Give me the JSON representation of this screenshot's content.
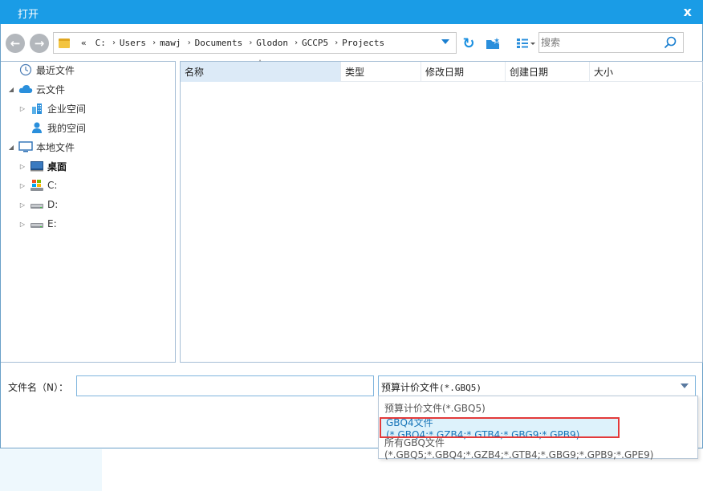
{
  "dialog": {
    "title": "打开",
    "close_glyph": "x"
  },
  "toolbar": {
    "back_icon": "arrow-left-icon",
    "forward_icon": "arrow-right-icon",
    "address": {
      "overflow": "«",
      "segments": [
        "C:",
        "Users",
        "mawj",
        "Documents",
        "Glodon",
        "GCCP5",
        "Projects"
      ],
      "separator": "›"
    },
    "refresh_icon": "refresh-icon",
    "new_folder_icon": "new-folder-icon",
    "view_icon": "view-mode-icon",
    "search": {
      "placeholder": "搜索"
    }
  },
  "tree": {
    "items": [
      {
        "label": "最近文件",
        "icon": "clock-icon",
        "expander": ""
      },
      {
        "label": "云文件",
        "icon": "cloud-icon",
        "expander": "◢"
      },
      {
        "label": "企业空间",
        "icon": "building-icon",
        "expander": "▷"
      },
      {
        "label": "我的空间",
        "icon": "user-icon",
        "expander": ""
      },
      {
        "label": "本地文件",
        "icon": "monitor-icon",
        "expander": "◢"
      },
      {
        "label": "桌面",
        "icon": "desktop-icon",
        "expander": "▷"
      },
      {
        "label": "C:",
        "icon": "windows-drive-icon",
        "expander": "▷"
      },
      {
        "label": "D:",
        "icon": "drive-icon",
        "expander": "▷"
      },
      {
        "label": "E:",
        "icon": "drive-icon",
        "expander": "▷"
      }
    ]
  },
  "filelist": {
    "columns": [
      "名称",
      "类型",
      "修改日期",
      "创建日期",
      "大小"
    ],
    "sort_caret": "˄"
  },
  "footer": {
    "filename_label": "文件名（N）：",
    "filename_value": "",
    "filetype": {
      "label": "预算计价文件",
      "pattern": "(*.GBQ5)"
    }
  },
  "dropdown": {
    "options": [
      "预算计价文件(*.GBQ5)",
      "GBQ4文件(*.GBQ4;*.GZB4;*.GTB4;*.GBG9;*.GPB9)",
      "所有GBQ文件(*.GBQ5;*.GBQ4;*.GZB4;*.GTB4;*.GBG9;*.GPB9;*.GPE9)"
    ],
    "selected_index": 1
  },
  "colors": {
    "titlebar": "#1a9ce6",
    "highlight_box": "#e33a3a",
    "selection_bg": "#ddf2fb"
  }
}
